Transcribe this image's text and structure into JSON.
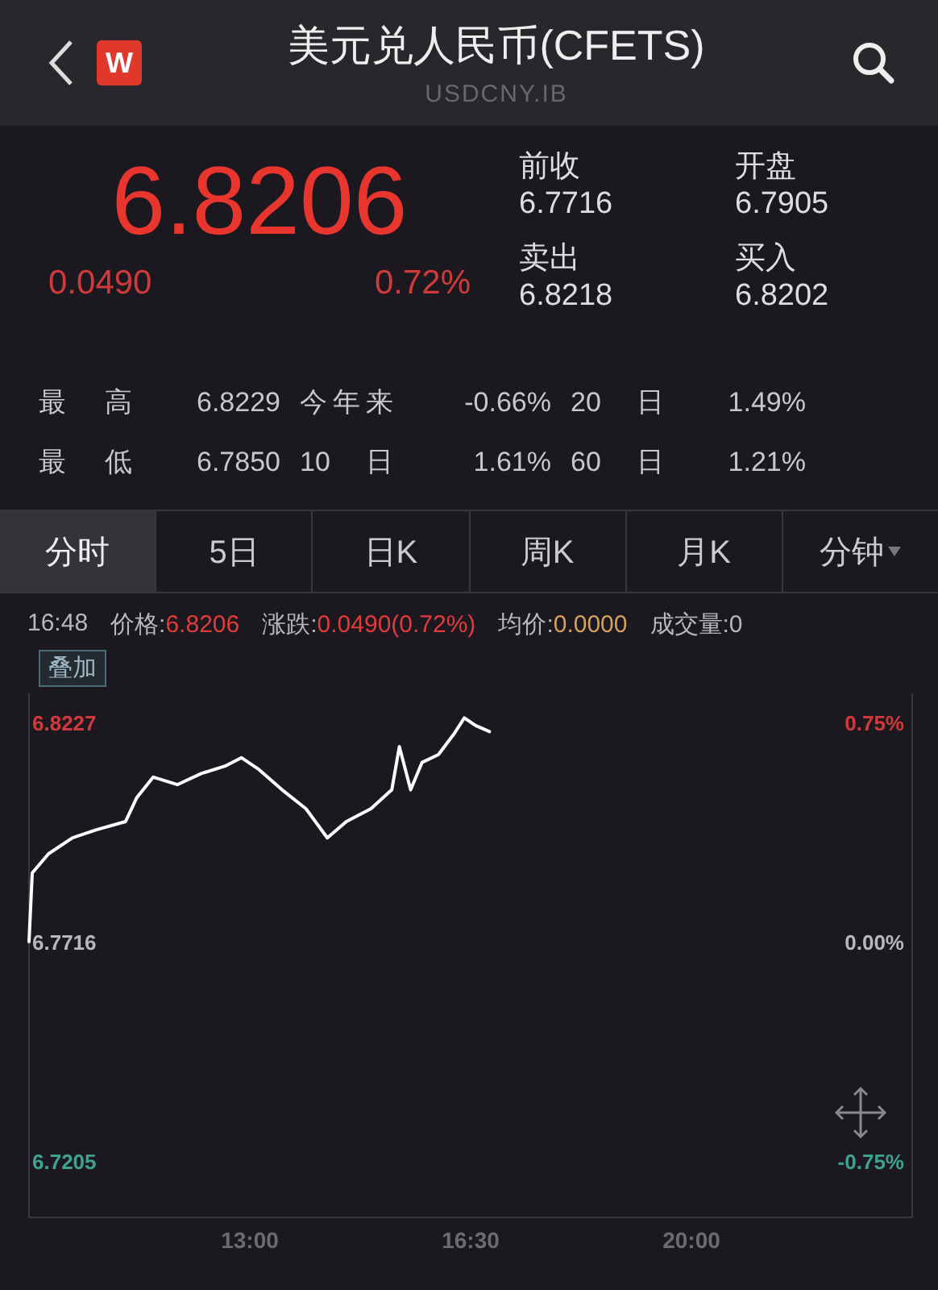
{
  "header": {
    "logo": "W",
    "title": "美元兑人民币(CFETS)",
    "subtitle": "USDCNY.IB"
  },
  "quote": {
    "price": "6.8206",
    "change": "0.0490",
    "change_pct": "0.72%",
    "fields": [
      {
        "label": "前收",
        "value": "6.7716"
      },
      {
        "label": "开盘",
        "value": "6.7905"
      },
      {
        "label": "卖出",
        "value": "6.8218"
      },
      {
        "label": "买入",
        "value": "6.8202"
      }
    ]
  },
  "stats": [
    [
      {
        "label": "最 高",
        "value": "6.8229"
      },
      {
        "label": "今年来",
        "value": "-0.66%"
      },
      {
        "label": "20 日",
        "value": "1.49%"
      }
    ],
    [
      {
        "label": "最 低",
        "value": "6.7850"
      },
      {
        "label": "10 日",
        "value": "1.61%"
      },
      {
        "label": "60 日",
        "value": "1.21%"
      }
    ]
  ],
  "tabs": [
    {
      "label": "分时",
      "selected": true,
      "dropdown": false
    },
    {
      "label": "5日",
      "selected": false,
      "dropdown": false
    },
    {
      "label": "日K",
      "selected": false,
      "dropdown": false
    },
    {
      "label": "周K",
      "selected": false,
      "dropdown": false
    },
    {
      "label": "月K",
      "selected": false,
      "dropdown": false
    },
    {
      "label": "分钟",
      "selected": false,
      "dropdown": true
    }
  ],
  "info": {
    "time": "16:48",
    "items": [
      {
        "label": "价格:",
        "value": "6.8206",
        "kind": "up"
      },
      {
        "label": "涨跌:",
        "value": "0.0490(0.72%)",
        "kind": "up"
      },
      {
        "label": "均价:",
        "value": "0.0000",
        "kind": "avg"
      },
      {
        "label": "成交量:",
        "value": "0",
        "kind": "plain"
      }
    ]
  },
  "overlay_button": "叠加",
  "chart": {
    "right_labels": [
      "0.75%",
      "0.00%",
      "-0.75%"
    ],
    "chart_data": {
      "type": "line",
      "x": [
        9.5,
        9.55,
        9.81,
        10.19,
        10.57,
        11.03,
        11.21,
        11.47,
        11.85,
        12.23,
        12.62,
        12.87,
        13.13,
        13.51,
        13.89,
        14.23,
        14.53,
        14.92,
        15.25,
        15.37,
        15.55,
        15.73,
        15.99,
        16.24,
        16.4,
        16.58,
        16.8
      ],
      "series": [
        {
          "color": "#ffffff",
          "values": [
            6.7716,
            6.7876,
            6.7921,
            6.7958,
            6.7977,
            6.7996,
            6.8052,
            6.81,
            6.8082,
            6.8108,
            6.8126,
            6.8145,
            6.8119,
            6.807,
            6.8026,
            6.7958,
            6.7996,
            6.8026,
            6.807,
            6.8171,
            6.807,
            6.8134,
            6.8152,
            6.8201,
            6.8238,
            6.822,
            6.8206
          ]
        }
      ],
      "xlim": [
        9.5,
        23.5
      ],
      "ylim": [
        6.7073,
        6.8295
      ],
      "xticks": [
        {
          "value": 13,
          "label": "13:00"
        },
        {
          "value": 16.5,
          "label": "16:30"
        },
        {
          "value": 20,
          "label": "20:00"
        }
      ],
      "yticks": [
        6.8227,
        6.7716,
        6.7205
      ]
    }
  }
}
